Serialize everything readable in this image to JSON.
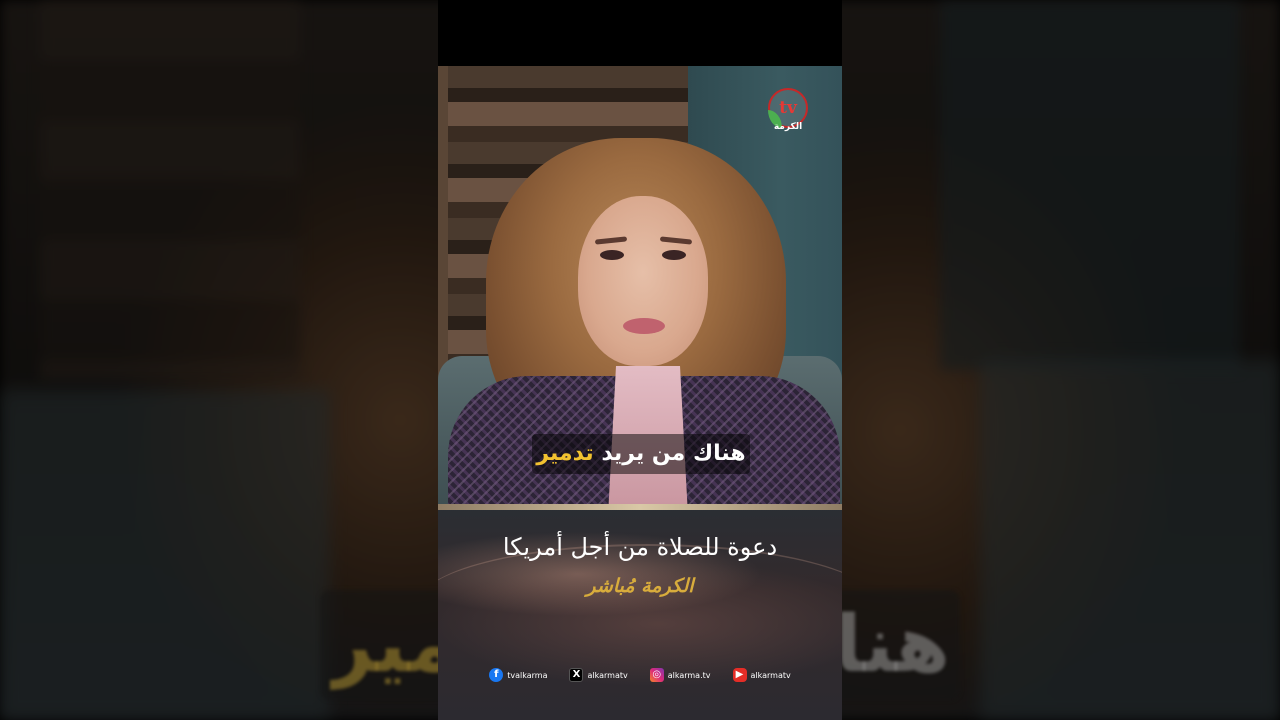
{
  "video": {
    "logo_text": "tv",
    "channel_name": "الكرمة",
    "subtitle_prefix": "هناك من يريد",
    "subtitle_highlight": "تدمير",
    "headline": "دعوة للصلاة من أجل أمريكا",
    "program_name": "الكرمة مُباشر",
    "social": [
      {
        "icon": "facebook-icon",
        "glyph": "f",
        "label": "tvalkarma"
      },
      {
        "icon": "x-icon",
        "glyph": "X",
        "label": "alkarmatv"
      },
      {
        "icon": "instagram-icon",
        "glyph": "◎",
        "label": "alkarma.tv"
      },
      {
        "icon": "youtube-icon",
        "glyph": "▶",
        "label": "alkarmatv"
      }
    ]
  },
  "backdrop": {
    "caption_prefix": "هناك",
    "caption_highlight": "تدمير"
  },
  "colors": {
    "highlight": "#f2c230",
    "program": "#d8ac3c",
    "logo_red": "#e53935"
  }
}
